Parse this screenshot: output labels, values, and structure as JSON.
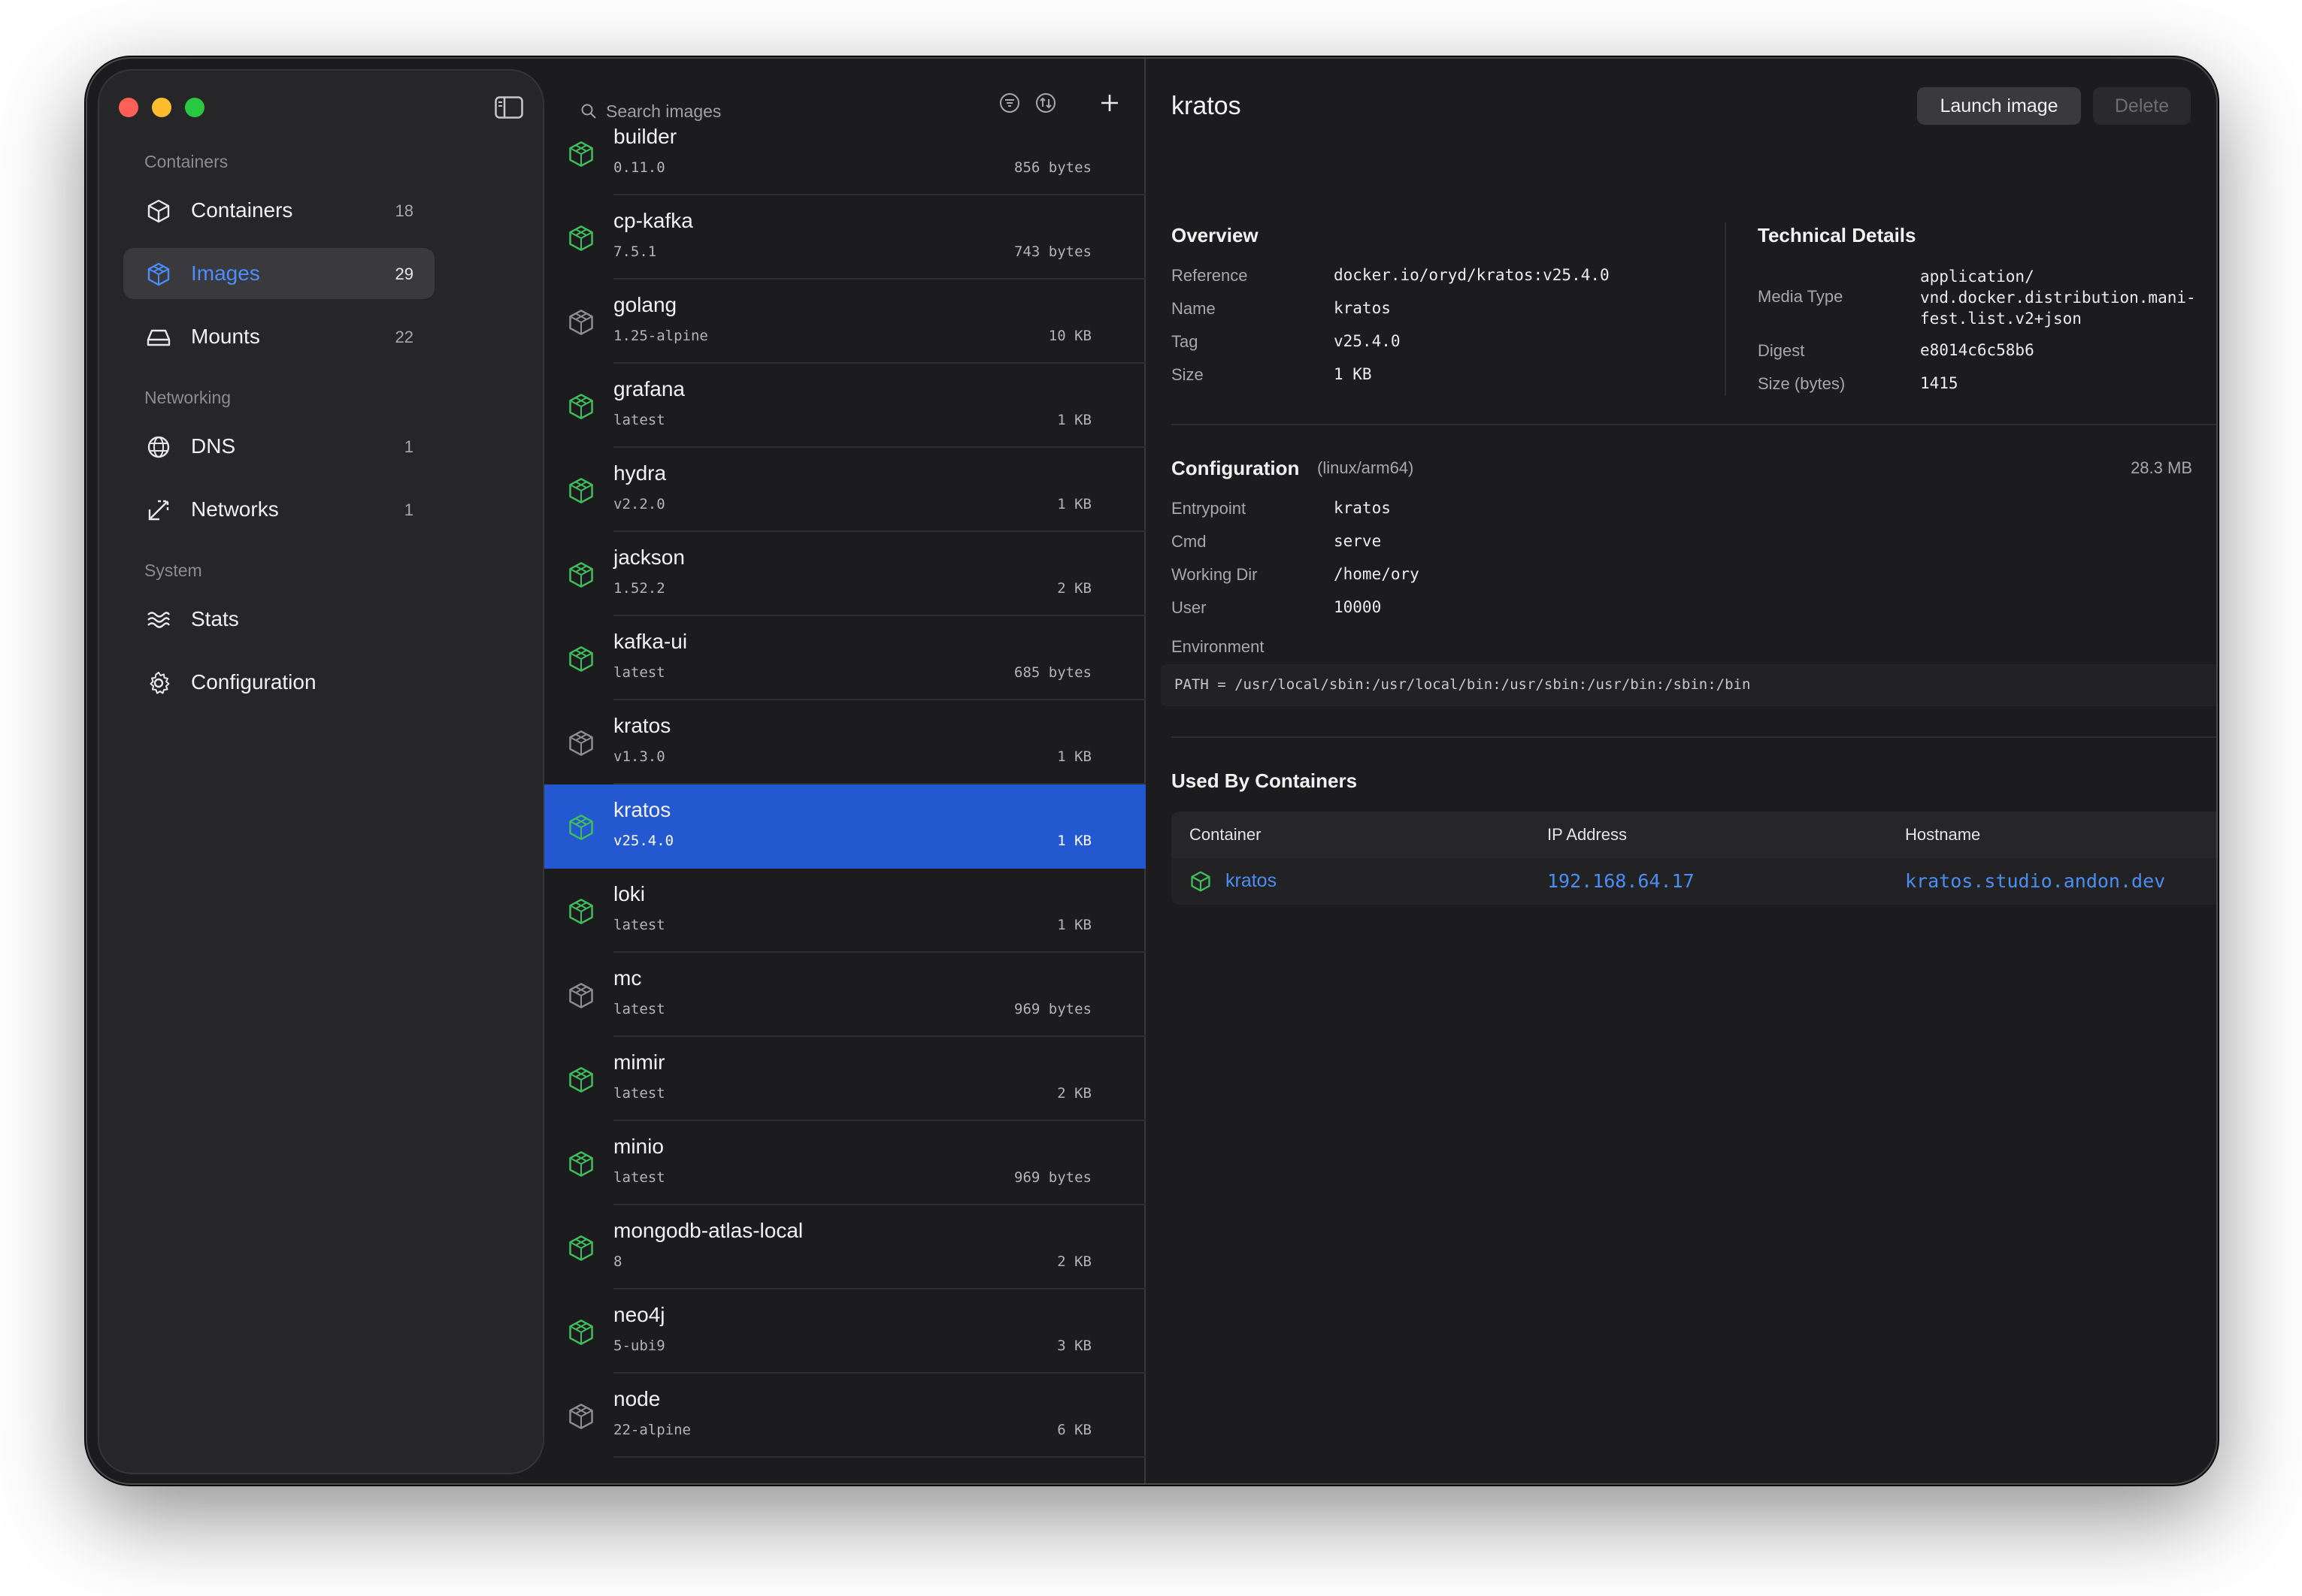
{
  "window": {
    "traffic_lights": [
      "close",
      "minimize",
      "zoom"
    ]
  },
  "sidebar": {
    "sections": [
      {
        "label": "Containers",
        "items": [
          {
            "label": "Containers",
            "count": "18",
            "icon": "cube-icon",
            "active": false
          },
          {
            "label": "Images",
            "count": "29",
            "icon": "image-cube-icon",
            "active": true
          },
          {
            "label": "Mounts",
            "count": "22",
            "icon": "drive-icon",
            "active": false
          }
        ]
      },
      {
        "label": "Networking",
        "items": [
          {
            "label": "DNS",
            "count": "1",
            "icon": "globe-icon",
            "active": false
          },
          {
            "label": "Networks",
            "count": "1",
            "icon": "network-arrows-icon",
            "active": false
          }
        ]
      },
      {
        "label": "System",
        "items": [
          {
            "label": "Stats",
            "count": "",
            "icon": "waves-icon",
            "active": false
          },
          {
            "label": "Configuration",
            "count": "",
            "icon": "gear-icon",
            "active": false
          }
        ]
      }
    ]
  },
  "image_list": {
    "search_placeholder": "Search images",
    "images": [
      {
        "name": "builder",
        "tag": "0.11.0",
        "size": "856 bytes",
        "in_use": true
      },
      {
        "name": "cp-kafka",
        "tag": "7.5.1",
        "size": "743 bytes",
        "in_use": true
      },
      {
        "name": "golang",
        "tag": "1.25-alpine",
        "size": "10 KB",
        "in_use": false
      },
      {
        "name": "grafana",
        "tag": "latest",
        "size": "1 KB",
        "in_use": true
      },
      {
        "name": "hydra",
        "tag": "v2.2.0",
        "size": "1 KB",
        "in_use": true
      },
      {
        "name": "jackson",
        "tag": "1.52.2",
        "size": "2 KB",
        "in_use": true
      },
      {
        "name": "kafka-ui",
        "tag": "latest",
        "size": "685 bytes",
        "in_use": true
      },
      {
        "name": "kratos",
        "tag": "v1.3.0",
        "size": "1 KB",
        "in_use": false
      },
      {
        "name": "kratos",
        "tag": "v25.4.0",
        "size": "1 KB",
        "in_use": true,
        "selected": true
      },
      {
        "name": "loki",
        "tag": "latest",
        "size": "1 KB",
        "in_use": true
      },
      {
        "name": "mc",
        "tag": "latest",
        "size": "969 bytes",
        "in_use": false
      },
      {
        "name": "mimir",
        "tag": "latest",
        "size": "2 KB",
        "in_use": true
      },
      {
        "name": "minio",
        "tag": "latest",
        "size": "969 bytes",
        "in_use": true
      },
      {
        "name": "mongodb-atlas-local",
        "tag": "8",
        "size": "2 KB",
        "in_use": true
      },
      {
        "name": "neo4j",
        "tag": "5-ubi9",
        "size": "3 KB",
        "in_use": true
      },
      {
        "name": "node",
        "tag": "22-alpine",
        "size": "6 KB",
        "in_use": false
      }
    ]
  },
  "detail": {
    "title": "kratos",
    "launch_label": "Launch image",
    "delete_label": "Delete",
    "overview": {
      "heading": "Overview",
      "rows": [
        {
          "key": "Reference",
          "value": "docker.io/oryd/kratos:v25.4.0"
        },
        {
          "key": "Name",
          "value": "kratos"
        },
        {
          "key": "Tag",
          "value": "v25.4.0"
        },
        {
          "key": "Size",
          "value": "1 KB"
        }
      ]
    },
    "technical": {
      "heading": "Technical Details",
      "rows": [
        {
          "key": "Media Type",
          "value": "application/\nvnd.docker.distribution.mani-\nfest.list.v2+json"
        },
        {
          "key": "Digest",
          "value": "e8014c6c58b6"
        },
        {
          "key": "Size (bytes)",
          "value": "1415"
        }
      ]
    },
    "configuration": {
      "heading": "Configuration",
      "platform": "(linux/arm64)",
      "size": "28.3 MB",
      "rows": [
        {
          "key": "Entrypoint",
          "value": "kratos"
        },
        {
          "key": "Cmd",
          "value": "serve"
        },
        {
          "key": "Working Dir",
          "value": "/home/ory"
        },
        {
          "key": "User",
          "value": "10000"
        }
      ],
      "environment_label": "Environment",
      "environment": "PATH = /usr/local/sbin:/usr/local/bin:/usr/sbin:/usr/bin:/sbin:/bin"
    },
    "used_by": {
      "heading": "Used By Containers",
      "columns": [
        "Container",
        "IP Address",
        "Hostname"
      ],
      "rows": [
        {
          "container": "kratos",
          "ip": "192.168.64.17",
          "hostname": "kratos.studio.andon.dev"
        }
      ]
    }
  },
  "colors": {
    "accent": "#2458d0",
    "link": "#4a8ef5",
    "in_use_icon": "#3fbf5a",
    "idle_icon": "#8e8e92"
  }
}
